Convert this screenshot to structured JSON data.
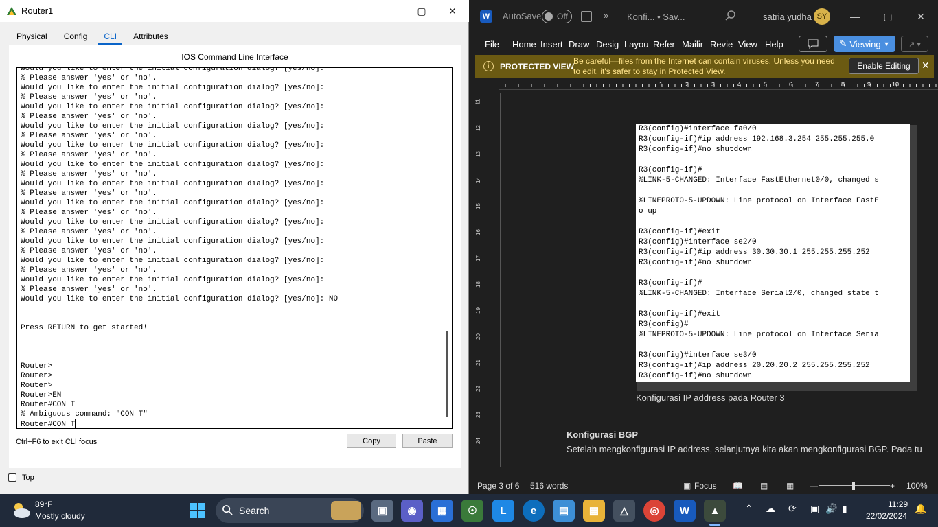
{
  "pt": {
    "title": "Router1",
    "tabs": [
      "Physical",
      "Config",
      "CLI",
      "Attributes"
    ],
    "active_tab": "CLI",
    "cli_header": "IOS Command Line Interface",
    "cli_lines": [
      "Would you like to enter the initial configuration dialog? [yes/no]:",
      "% Please answer 'yes' or 'no'.",
      "Would you like to enter the initial configuration dialog? [yes/no]:",
      "% Please answer 'yes' or 'no'.",
      "Would you like to enter the initial configuration dialog? [yes/no]:",
      "% Please answer 'yes' or 'no'.",
      "Would you like to enter the initial configuration dialog? [yes/no]:",
      "% Please answer 'yes' or 'no'.",
      "Would you like to enter the initial configuration dialog? [yes/no]:",
      "% Please answer 'yes' or 'no'.",
      "Would you like to enter the initial configuration dialog? [yes/no]:",
      "% Please answer 'yes' or 'no'.",
      "Would you like to enter the initial configuration dialog? [yes/no]:",
      "% Please answer 'yes' or 'no'.",
      "Would you like to enter the initial configuration dialog? [yes/no]:",
      "% Please answer 'yes' or 'no'.",
      "Would you like to enter the initial configuration dialog? [yes/no]:",
      "% Please answer 'yes' or 'no'.",
      "Would you like to enter the initial configuration dialog? [yes/no]:",
      "% Please answer 'yes' or 'no'.",
      "Would you like to enter the initial configuration dialog? [yes/no]:",
      "% Please answer 'yes' or 'no'.",
      "Would you like to enter the initial configuration dialog? [yes/no]:",
      "% Please answer 'yes' or 'no'.",
      "Would you like to enter the initial configuration dialog? [yes/no]: NO",
      "",
      "",
      "Press RETURN to get started!",
      "",
      "",
      "",
      "Router>",
      "Router>",
      "Router>",
      "Router>EN",
      "Router#CON T",
      "% Ambiguous command: \"CON T\"",
      "Router#CON T"
    ],
    "hint": "Ctrl+F6 to exit CLI focus",
    "copy_label": "Copy",
    "paste_label": "Paste",
    "top_label": "Top"
  },
  "word": {
    "autosave_label": "AutoSave",
    "autosave_state": "Off",
    "doc_title": "Konfi... • Sav...",
    "user_name": "satria yudha",
    "user_initials": "SY",
    "menu": [
      "File",
      "Home",
      "Insert",
      "Draw",
      "Desig",
      "Layou",
      "Refer",
      "Mailir",
      "Revie",
      "View",
      "Help"
    ],
    "viewing_label": "Viewing",
    "protected_title": "PROTECTED VIEW",
    "protected_msg": "Be careful—files from the Internet can contain viruses. Unless you need to edit, it's safer to stay in Protected View.",
    "enable_editing": "Enable Editing",
    "ruler_numbers": [
      "1",
      "2",
      "3",
      "4",
      "5",
      "6",
      "7",
      "8",
      "9",
      "10"
    ],
    "vruler_numbers": [
      "11",
      "12",
      "13",
      "14",
      "15",
      "16",
      "17",
      "18",
      "19",
      "20",
      "21",
      "22",
      "23",
      "24"
    ],
    "image_lines": [
      "R3(config)#interface fa0/0",
      "R3(config-if)#ip address 192.168.3.254 255.255.255.0",
      "R3(config-if)#no shutdown",
      "",
      "R3(config-if)#",
      "%LINK-5-CHANGED: Interface FastEthernet0/0, changed s",
      "",
      "%LINEPROTO-5-UPDOWN: Line protocol on Interface FastE",
      "o up",
      "",
      "R3(config-if)#exit",
      "R3(config)#interface se2/0",
      "R3(config-if)#ip address 30.30.30.1 255.255.255.252",
      "R3(config-if)#no shutdown",
      "",
      "R3(config-if)#",
      "%LINK-5-CHANGED: Interface Serial2/0, changed state t",
      "",
      "R3(config-if)#exit",
      "R3(config)#",
      "%LINEPROTO-5-UPDOWN: Line protocol on Interface Seria",
      "",
      "R3(config)#interface se3/0",
      "R3(config-if)#ip address 20.20.20.2 255.255.255.252",
      "R3(config-if)#no shutdown"
    ],
    "caption": "Konfigurasi IP address pada Router 3",
    "heading": "Konfigurasi BGP",
    "paragraph": "Setelah mengkonfigurasi IP address, selanjutnya kita akan mengkonfigurasi BGP. Pada tu",
    "page_label": "Page 3 of 6",
    "words_label": "516 words",
    "focus_label": "Focus",
    "zoom_label": "100%"
  },
  "taskbar": {
    "temp": "89°F",
    "weather": "Mostly cloudy",
    "search_label": "Search",
    "time": "11:29",
    "date": "22/02/2024"
  },
  "colors": {
    "accent": "#0a64c8",
    "word_blue": "#185abd",
    "protected_bar": "#6b5a12",
    "taskbar": "#202a3a"
  }
}
